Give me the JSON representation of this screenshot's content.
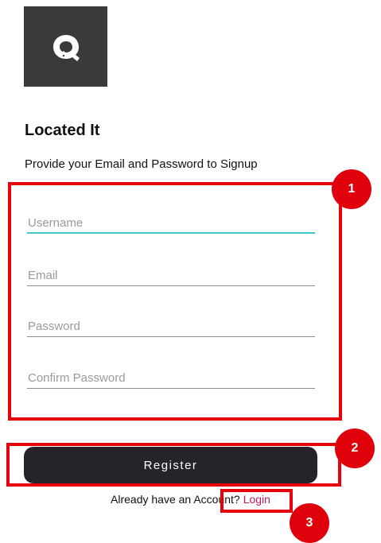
{
  "app": {
    "title": "Located It",
    "subtitle": "Provide your Email and Password to Signup",
    "logo_icon": "q-house-logo-icon"
  },
  "form": {
    "username_placeholder": "Username",
    "email_placeholder": "Email",
    "password_placeholder": "Password",
    "confirm_password_placeholder": "Confirm Password"
  },
  "actions": {
    "register_label": "Register",
    "login_prompt": "Already have an Account?",
    "login_label": "Login"
  },
  "annotations": {
    "badge_1": "1",
    "badge_2": "2",
    "badge_3": "3"
  },
  "colors": {
    "accent_underline": "#3fc8c4",
    "button_bg": "#27232b",
    "login_link": "#c2185b",
    "annotation_red": "#e8000c"
  }
}
